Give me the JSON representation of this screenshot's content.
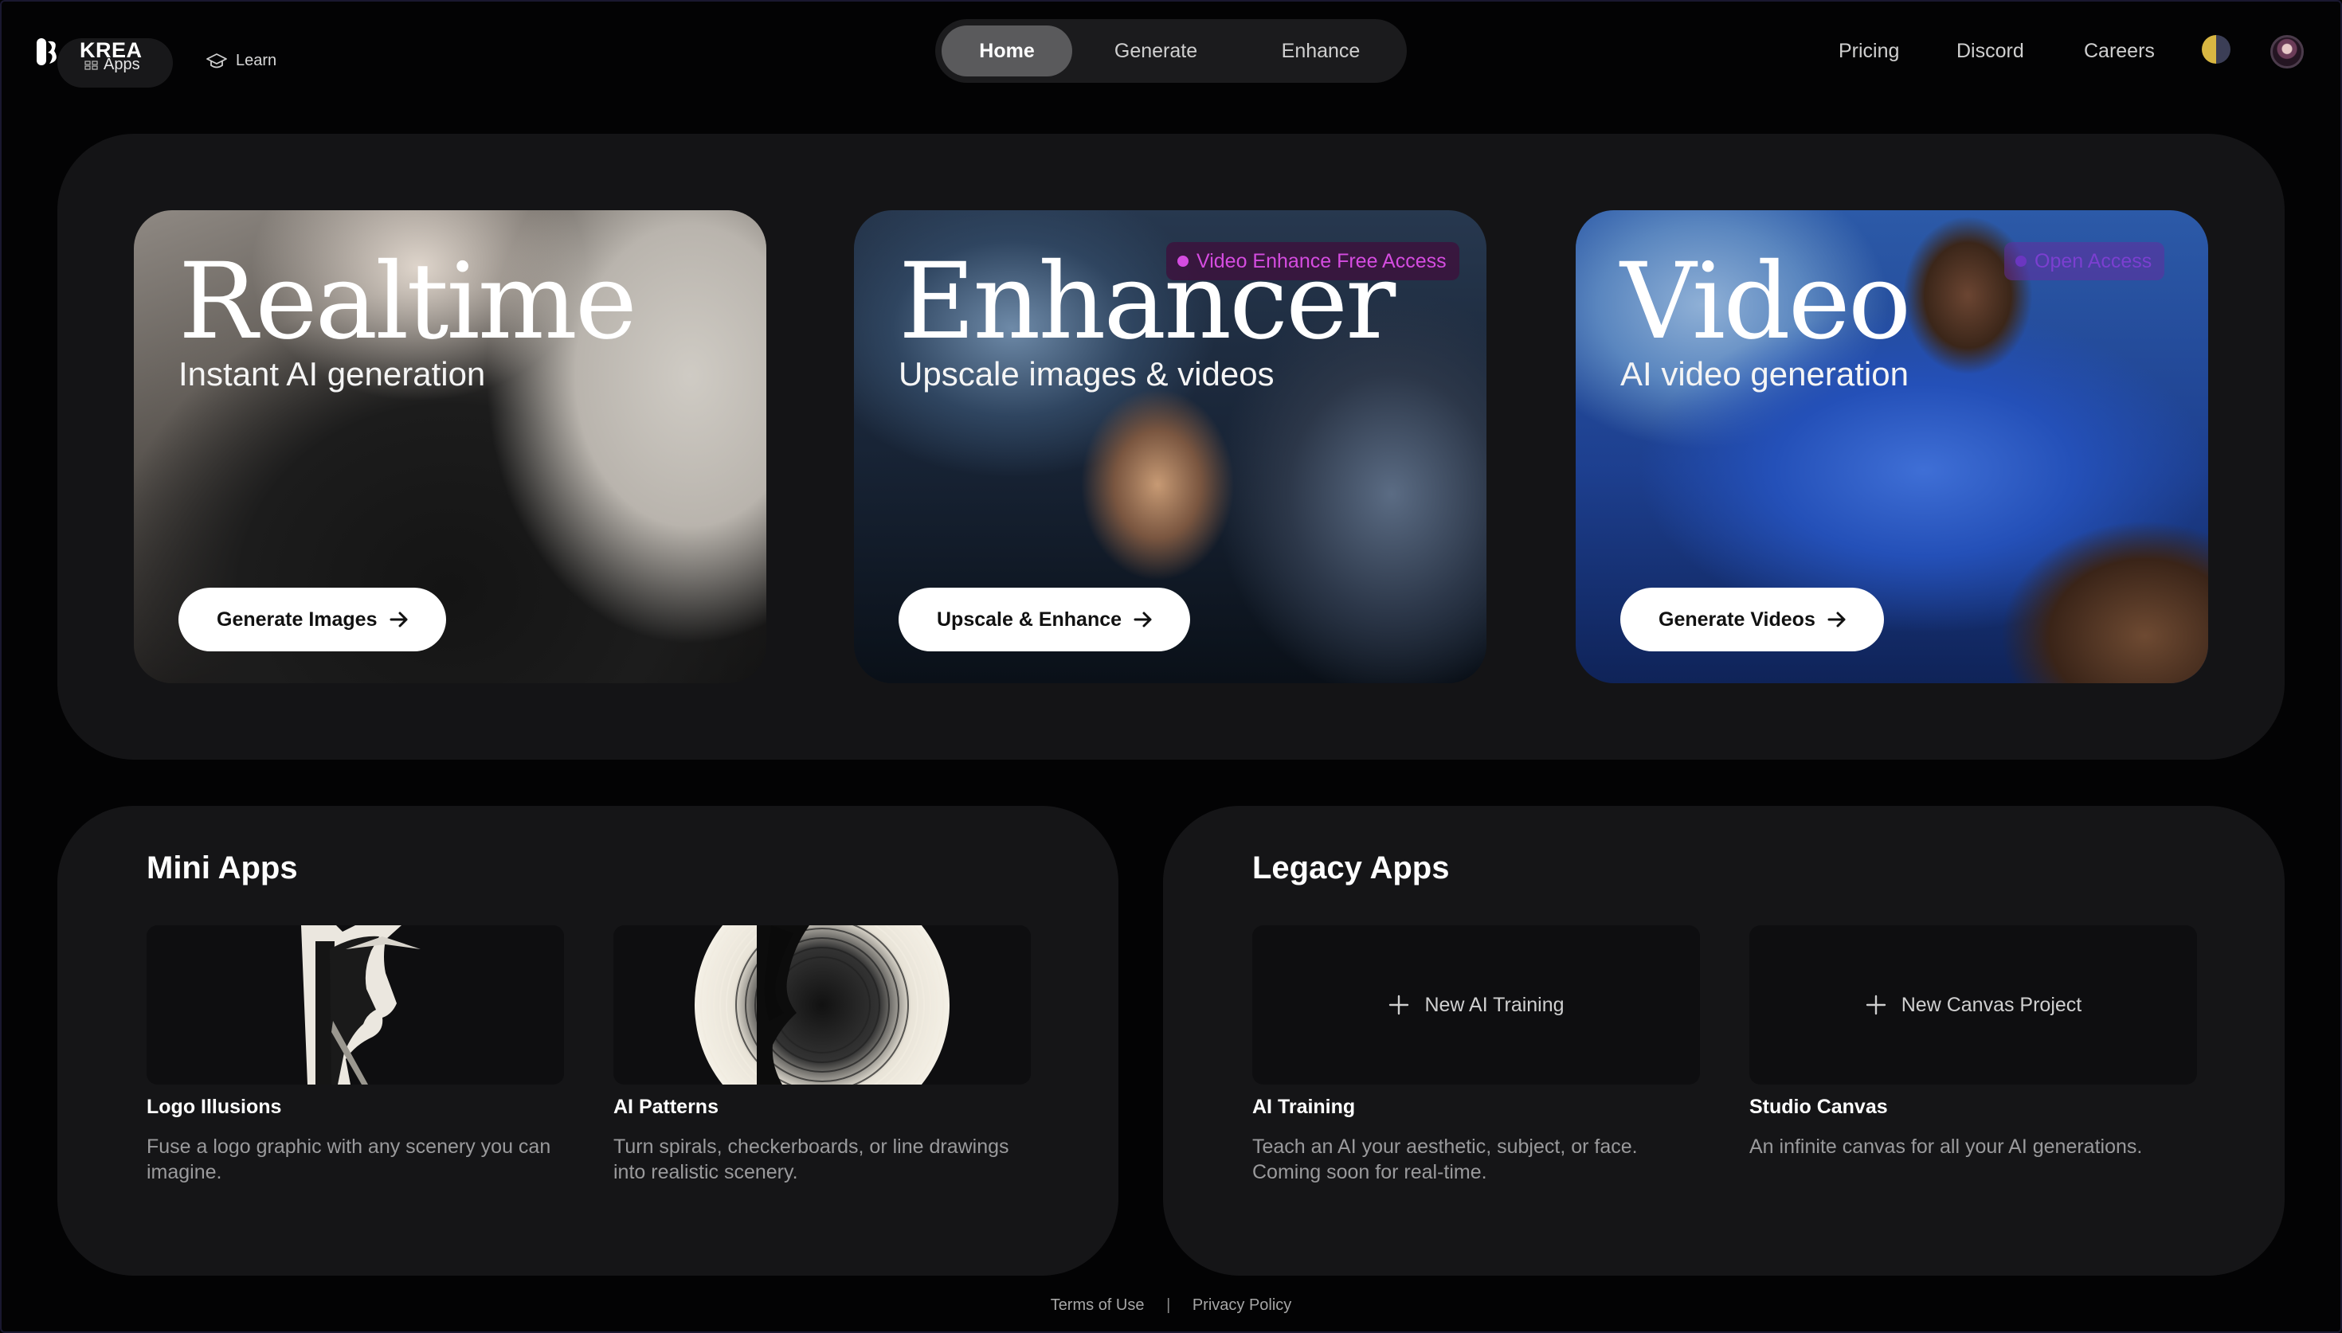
{
  "header": {
    "brand": "KREA",
    "apps_label": "Apps",
    "learn_label": "Learn",
    "tabs": [
      {
        "label": "Home",
        "active": true
      },
      {
        "label": "Generate",
        "active": false
      },
      {
        "label": "Enhance",
        "active": false
      }
    ],
    "nav": [
      "Pricing",
      "Discord",
      "Careers"
    ]
  },
  "hero": {
    "cards": [
      {
        "title": "Realtime",
        "subtitle": "Instant AI generation",
        "button": "Generate Images",
        "badge": ""
      },
      {
        "title": "Enhancer",
        "subtitle": "Upscale images & videos",
        "button": "Upscale & Enhance",
        "badge": "Video Enhance Free Access"
      },
      {
        "title": "Video",
        "subtitle": "AI video generation",
        "button": "Generate Videos",
        "badge": "Open Access"
      }
    ]
  },
  "mini_apps": {
    "title": "Mini Apps",
    "items": [
      {
        "name": "Logo Illusions",
        "description": "Fuse a logo graphic with any scenery you can imagine."
      },
      {
        "name": "AI Patterns",
        "description": "Turn spirals, checkerboards, or line drawings into realistic scenery."
      }
    ]
  },
  "legacy_apps": {
    "title": "Legacy Apps",
    "items": [
      {
        "action": "New AI Training",
        "name": "AI Training",
        "description": "Teach an AI your aesthetic, subject, or face. Coming soon for real-time."
      },
      {
        "action": "New Canvas Project",
        "name": "Studio Canvas",
        "description": "An infinite canvas for all your AI generations."
      }
    ]
  },
  "footer": {
    "terms": "Terms of Use",
    "separator": "|",
    "privacy": "Privacy Policy"
  },
  "colors": {
    "page_bg": "#030304",
    "panel_bg": "#141416",
    "active_tab": "#5a5a5c",
    "badge_magenta": "#d54ce0",
    "badge_purple": "#7b3fd0"
  },
  "icons": [
    "krea-logo-icon",
    "apps-grid-icon",
    "graduation-cap-icon",
    "arrow-right-icon",
    "plus-icon",
    "theme-toggle-icon",
    "avatar"
  ]
}
